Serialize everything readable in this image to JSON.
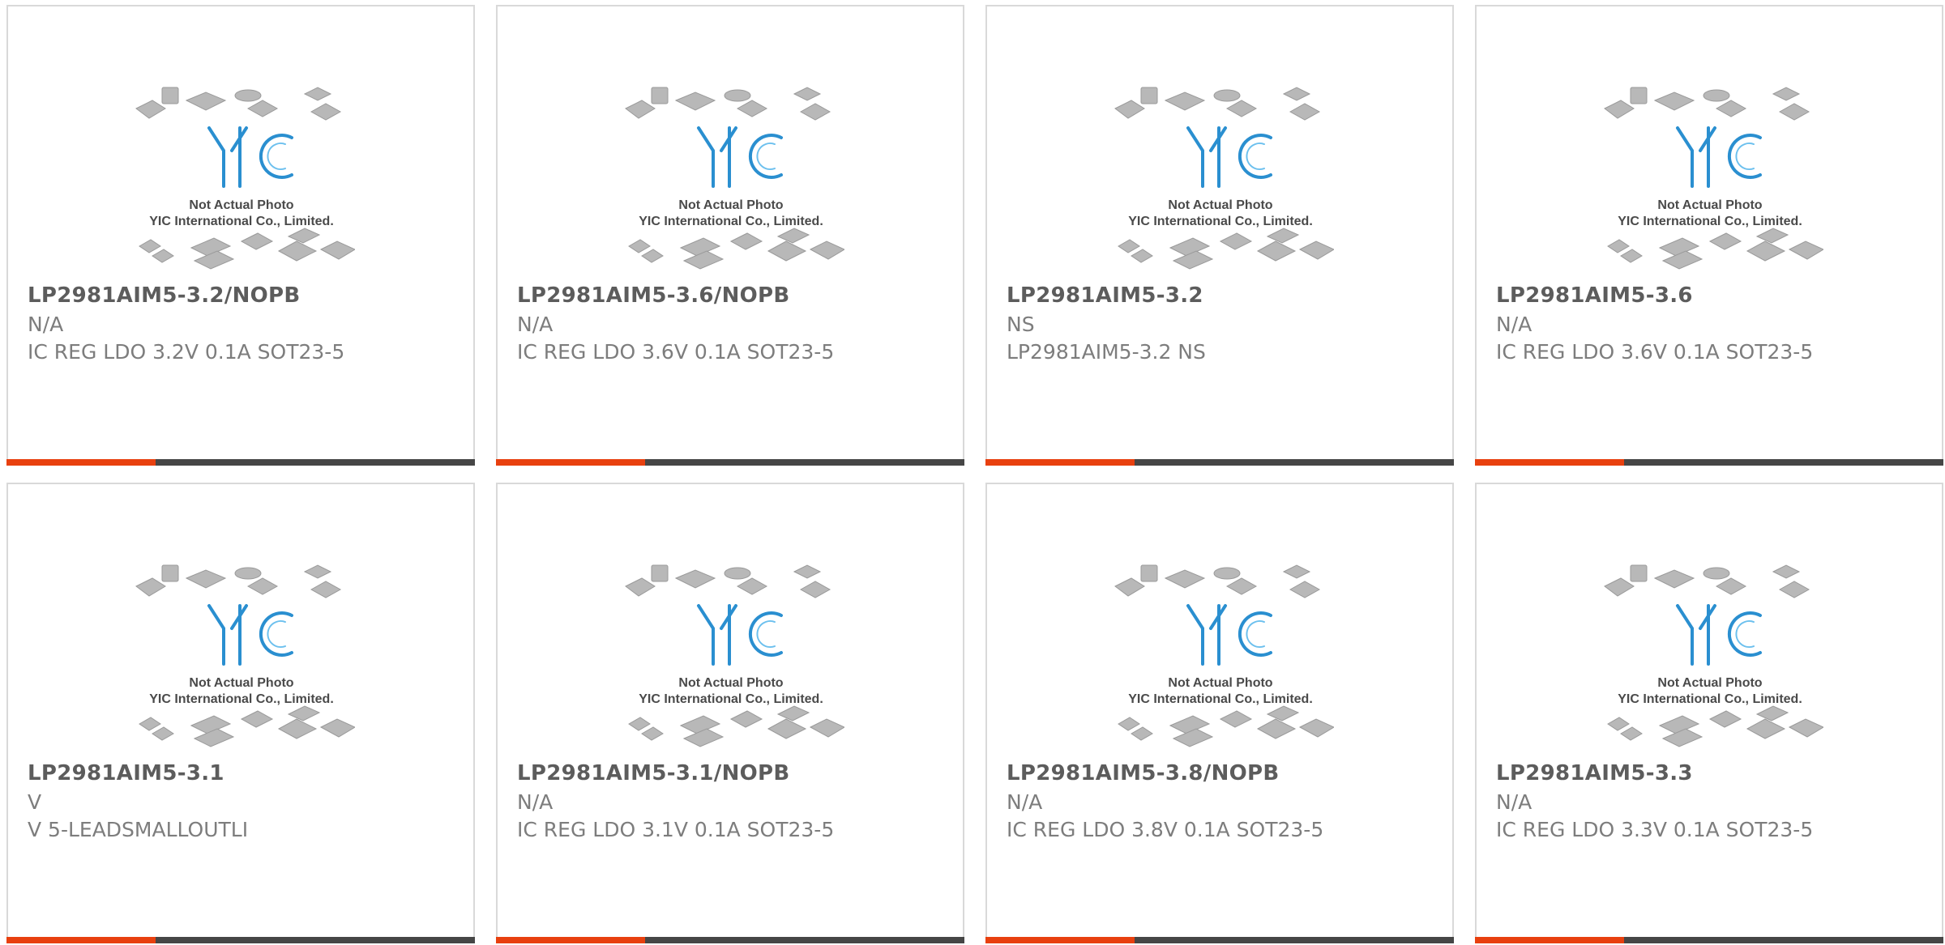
{
  "thumbnail": {
    "logo_text": "YIC",
    "caption_line1": "Not Actual Photo",
    "caption_line2": "YIC International Co., Limited."
  },
  "colors": {
    "accent": "#e8400f",
    "bar": "#464646",
    "border": "#d9d9d9",
    "logo_blue": "#2a8fd0"
  },
  "products": [
    {
      "part": "LP2981AIM5-3.2/NOPB",
      "manufacturer": "N/A",
      "description": "IC REG LDO 3.2V 0.1A SOT23-5"
    },
    {
      "part": "LP2981AIM5-3.6/NOPB",
      "manufacturer": "N/A",
      "description": "IC REG LDO 3.6V 0.1A SOT23-5"
    },
    {
      "part": "LP2981AIM5-3.2",
      "manufacturer": "NS",
      "description": "LP2981AIM5-3.2 NS"
    },
    {
      "part": "LP2981AIM5-3.6",
      "manufacturer": "N/A",
      "description": "IC REG LDO 3.6V 0.1A SOT23-5"
    },
    {
      "part": "LP2981AIM5-3.1",
      "manufacturer": "V",
      "description": "V 5-LEADSMALLOUTLI"
    },
    {
      "part": "LP2981AIM5-3.1/NOPB",
      "manufacturer": "N/A",
      "description": "IC REG LDO 3.1V 0.1A SOT23-5"
    },
    {
      "part": "LP2981AIM5-3.8/NOPB",
      "manufacturer": "N/A",
      "description": "IC REG LDO 3.8V 0.1A SOT23-5"
    },
    {
      "part": "LP2981AIM5-3.3",
      "manufacturer": "N/A",
      "description": "IC REG LDO 3.3V 0.1A SOT23-5"
    }
  ]
}
